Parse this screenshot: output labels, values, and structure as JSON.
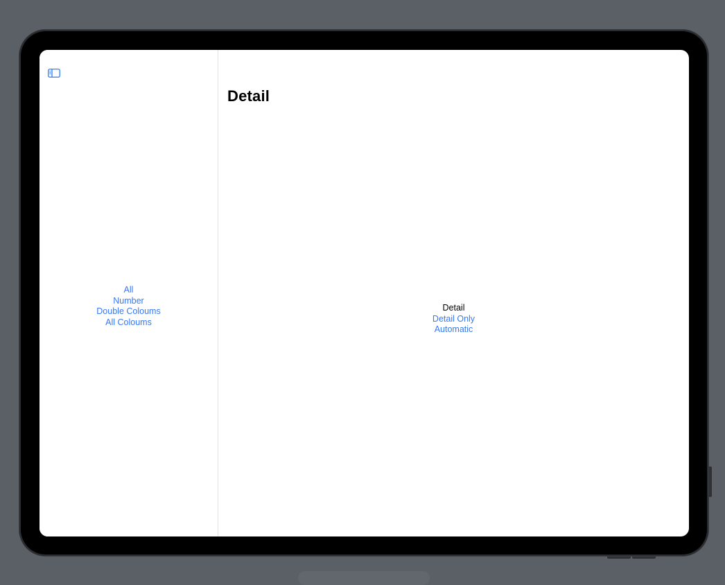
{
  "colors": {
    "accent": "#3478f6",
    "background": "#5b6067",
    "bezel": "#000000",
    "screen": "#ffffff",
    "divider": "#e3e3e6"
  },
  "sidebar": {
    "toggle_icon": "sidebar-left-icon",
    "items": [
      {
        "label": "All"
      },
      {
        "label": "Number"
      },
      {
        "label": "Double Coloums"
      },
      {
        "label": "All Coloums"
      }
    ]
  },
  "detail": {
    "title": "Detail",
    "current_label": "Detail",
    "items": [
      {
        "label": "Detail Only"
      },
      {
        "label": "Automatic"
      }
    ]
  }
}
